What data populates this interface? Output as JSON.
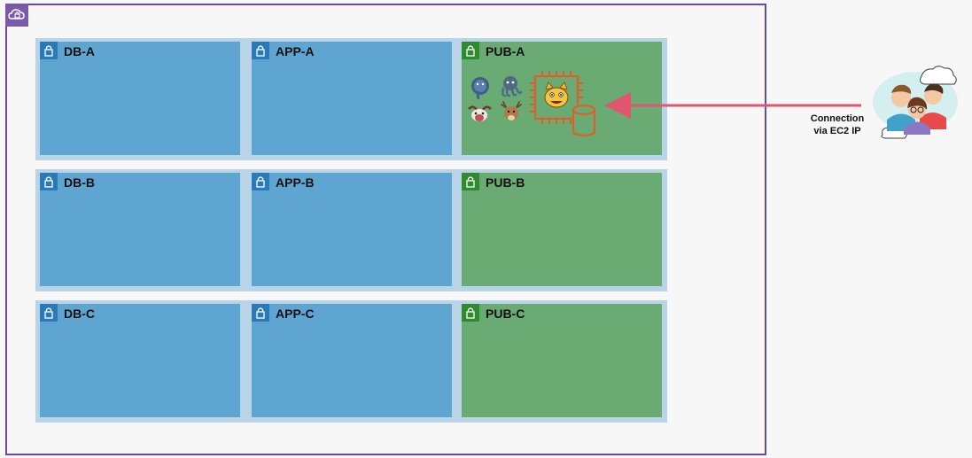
{
  "subnets": {
    "row_a": {
      "db": "DB-A",
      "app": "APP-A",
      "pub": "PUB-A"
    },
    "row_b": {
      "db": "DB-B",
      "app": "APP-B",
      "pub": "PUB-B"
    },
    "row_c": {
      "db": "DB-C",
      "app": "APP-C",
      "pub": "PUB-C"
    }
  },
  "connection": {
    "line1": "Connection",
    "line2": "via EC2 IP"
  },
  "colors": {
    "vpc_border": "#6b4ba1",
    "private_subnet": "#5fa5d1",
    "public_subnet": "#6aab74",
    "ec2_orange": "#d9622b",
    "arrow": "#e0566e"
  },
  "icons": [
    "vpc-cloud-icon",
    "lock-icon",
    "postgres-elephant-icon",
    "octopus-icon",
    "gnu-icon",
    "deer-icon",
    "ec2-chip-icon",
    "cat-face-icon",
    "database-cylinder-icon",
    "users-group-icon"
  ]
}
